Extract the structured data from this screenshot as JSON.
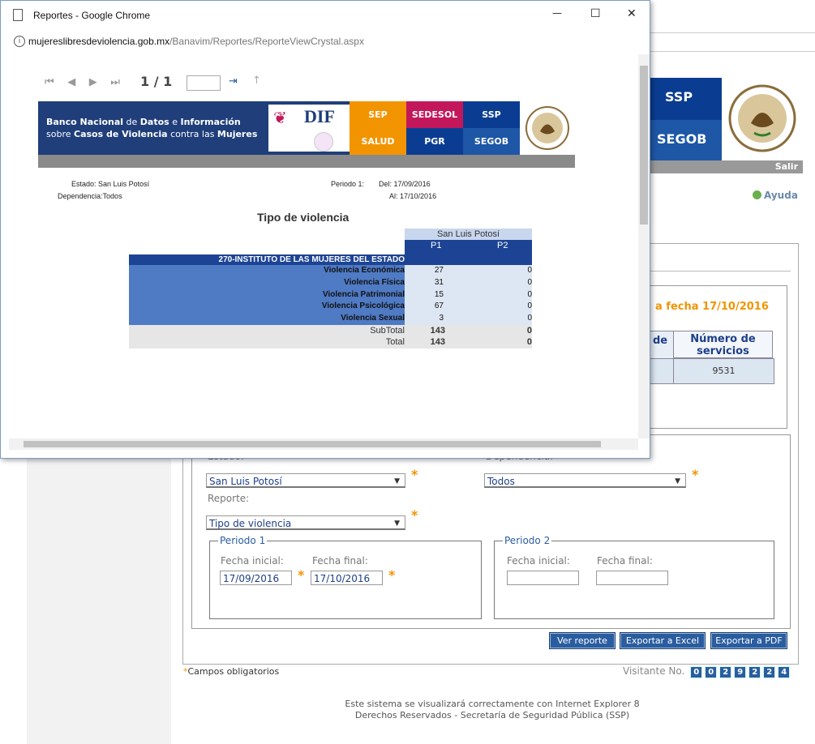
{
  "background": {
    "header": {
      "ssp": "SSP",
      "segob": "SEGOB",
      "salir": "Salir",
      "ayuda": "Ayuda"
    },
    "date_header": "a fecha 17/10/2016",
    "table": {
      "col2_header": "Número de servicios",
      "col1_header_fragment": "de",
      "value": "9531"
    },
    "form": {
      "estado_label": "Estado:",
      "estado_value": "San Luis Potosí",
      "dependencia_label": "Dependencia:",
      "dependencia_value": "Todos",
      "reporte_label": "Reporte:",
      "reporte_value": "Tipo de violencia",
      "periodo1_legend": "Periodo 1",
      "periodo2_legend": "Periodo 2",
      "fecha_inicial_label": "Fecha inicial:",
      "fecha_final_label": "Fecha final:",
      "p1_fecha_inicial": "17/09/2016",
      "p1_fecha_final": "17/10/2016",
      "p2_fecha_inicial": "",
      "p2_fecha_final": ""
    },
    "buttons": {
      "ver_reporte": "Ver reporte",
      "exportar_excel": "Exportar a Excel",
      "exportar_pdf": "Exportar a PDF"
    },
    "required_note": "Campos obligatorios",
    "required_star": "*",
    "visitor_label": "Visitante No.",
    "visitor_digits": [
      "0",
      "0",
      "2",
      "9",
      "2",
      "2",
      "4"
    ],
    "footer_line1": "Este sistema se visualizará correctamente con Internet Explorer 8",
    "footer_line2": "Derechos Reservados - Secretaría de Seguridad Pública (SSP)"
  },
  "popup": {
    "title": "Reportes - Google Chrome",
    "url_host": "mujereslibresdeviolencia.gob.mx",
    "url_path": "/Banavim/Reportes/ReporteViewCrystal.aspx",
    "minimize": "—",
    "maximize": "☐",
    "close": "✕",
    "page_indicator": "1 / 1",
    "page_input": "",
    "banner": {
      "line1_a": "Banco Nacional",
      "line1_b": " de ",
      "line1_c": "Datos",
      "line1_d": " e ",
      "line1_e": "Información",
      "line2_a": "sobre ",
      "line2_b": "Casos de Violencia",
      "line2_c": " contra las ",
      "line2_d": "Mujeres",
      "dif": "DIF",
      "tiles": [
        "SEP",
        "SEDESOL",
        "SSP",
        "SALUD",
        "PGR",
        "SEGOB"
      ]
    },
    "report": {
      "estado_label": "Estado:",
      "estado_value": "San Luis Potosí",
      "dependencia_label": "Dependencia:",
      "dependencia_value": "Todos",
      "periodo_label": "Periodo 1:",
      "del_label": "Del:",
      "del_value": "17/09/2016",
      "al_label": "Al:",
      "al_value": "17/10/2016",
      "title": "Tipo de violencia",
      "state_header": "San Luis Potosí",
      "col_p1": "P1",
      "col_p2": "P2",
      "institution": "270-INSTITUTO DE LAS MUJERES DEL ESTADO",
      "rows": [
        {
          "label": "Violencia Económica",
          "p1": "27",
          "p2": "0"
        },
        {
          "label": "Violencia Física",
          "p1": "31",
          "p2": "0"
        },
        {
          "label": "Violencia Patrimonial",
          "p1": "15",
          "p2": "0"
        },
        {
          "label": "Violencia Psicológica",
          "p1": "67",
          "p2": "0"
        },
        {
          "label": "Violencia Sexual",
          "p1": "3",
          "p2": "0"
        }
      ],
      "subtotal_label": "SubTotal",
      "subtotal_p1": "143",
      "subtotal_p2": "0",
      "total_label": "Total",
      "total_p1": "143",
      "total_p2": "0"
    }
  }
}
